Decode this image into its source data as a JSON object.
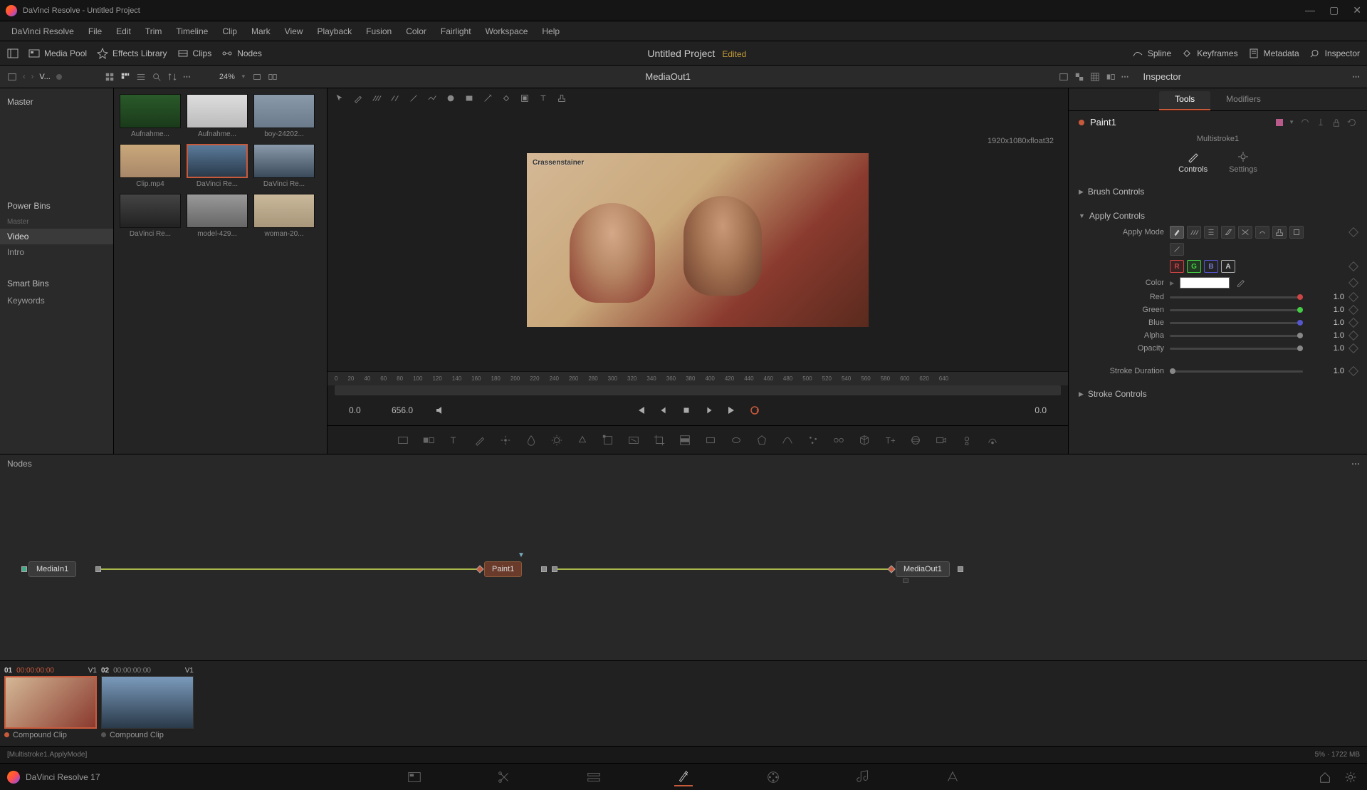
{
  "window": {
    "title": "DaVinci Resolve - Untitled Project"
  },
  "menu": [
    "DaVinci Resolve",
    "File",
    "Edit",
    "Trim",
    "Timeline",
    "Clip",
    "Mark",
    "View",
    "Playback",
    "Fusion",
    "Color",
    "Fairlight",
    "Workspace",
    "Help"
  ],
  "toolbar": {
    "media_pool": "Media Pool",
    "effects": "Effects Library",
    "clips_btn": "Clips",
    "nodes_btn": "Nodes",
    "project": "Untitled Project",
    "edited": "Edited",
    "spline": "Spline",
    "keyframes": "Keyframes",
    "metadata": "Metadata",
    "inspector": "Inspector"
  },
  "subbar": {
    "v": "V...",
    "zoom": "24%",
    "media_out": "MediaOut1",
    "inspector": "Inspector"
  },
  "mediapool": {
    "master": "Master",
    "power_bins": "Power Bins",
    "items": [
      "Master",
      "Video",
      "Intro"
    ],
    "smart_bins": "Smart Bins",
    "keywords": "Keywords"
  },
  "clips": [
    {
      "label": "Aufnahme..."
    },
    {
      "label": "Aufnahme..."
    },
    {
      "label": "boy-24202..."
    },
    {
      "label": "Clip.mp4"
    },
    {
      "label": "DaVinci Re...",
      "selected": true
    },
    {
      "label": "DaVinci Re..."
    },
    {
      "label": "DaVinci Re..."
    },
    {
      "label": "model-429..."
    },
    {
      "label": "woman-20..."
    }
  ],
  "viewer": {
    "meta": "1920x1080xfloat32",
    "overlay": "Crassenstainer",
    "tc_in": "0.0",
    "tc_range": "656.0",
    "tc_out": "0.0",
    "ruler": [
      "0",
      "20",
      "40",
      "60",
      "80",
      "100",
      "120",
      "140",
      "160",
      "180",
      "200",
      "220",
      "240",
      "260",
      "280",
      "300",
      "320",
      "340",
      "360",
      "380",
      "400",
      "420",
      "440",
      "460",
      "480",
      "500",
      "520",
      "540",
      "560",
      "580",
      "600",
      "620",
      "640"
    ]
  },
  "inspector": {
    "tabs": {
      "tools": "Tools",
      "modifiers": "Modifiers"
    },
    "node": "Paint1",
    "stroke": "Multistroke1",
    "modetabs": {
      "controls": "Controls",
      "settings": "Settings"
    },
    "sections": {
      "brush": "Brush Controls",
      "apply": "Apply Controls",
      "stroke_ctrl": "Stroke Controls"
    },
    "apply_mode": "Apply Mode",
    "channels": {
      "r": "R",
      "g": "G",
      "b": "B",
      "a": "A"
    },
    "color_lbl": "Color",
    "params": {
      "red": {
        "label": "Red",
        "value": "1.0"
      },
      "green": {
        "label": "Green",
        "value": "1.0"
      },
      "blue": {
        "label": "Blue",
        "value": "1.0"
      },
      "alpha": {
        "label": "Alpha",
        "value": "1.0"
      },
      "opacity": {
        "label": "Opacity",
        "value": "1.0"
      },
      "stroke_dur": {
        "label": "Stroke Duration",
        "value": "1.0"
      }
    }
  },
  "nodes": {
    "header": "Nodes",
    "MediaIn1": "MediaIn1",
    "Paint1": "Paint1",
    "MediaOut1": "MediaOut1"
  },
  "clipbar": {
    "items": [
      {
        "idx": "01",
        "tc": "00:00:00:00",
        "trk": "V1",
        "label": "Compound Clip",
        "selected": true
      },
      {
        "idx": "02",
        "tc": "00:00:00:00",
        "trk": "V1",
        "label": "Compound Clip"
      }
    ]
  },
  "status": {
    "left": "[Multistroke1.ApplyMode]",
    "right": "5% · 1722 MB"
  },
  "pagebar": {
    "app": "DaVinci Resolve 17"
  }
}
